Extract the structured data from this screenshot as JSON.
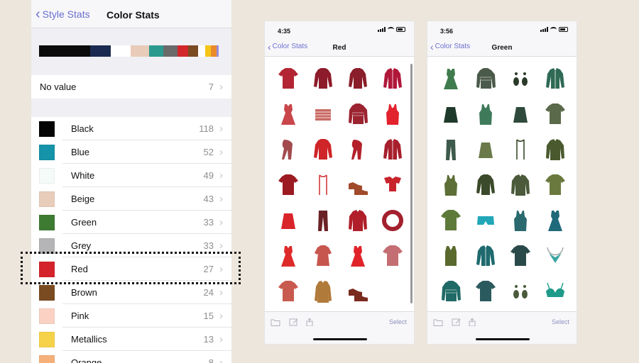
{
  "left_phone": {
    "back_label": "Style Stats",
    "title": "Color Stats",
    "swatch_bar": [
      "#0b0b0b",
      "#0b0b0b",
      "#1b2a50",
      "#ffffff",
      "#e8cbb8",
      "#2a9a8e",
      "#6a6a6a",
      "#d2262b",
      "#7a4a22",
      "#ffffff",
      "#f5c518",
      "#e98a2b",
      "#9b8cd9"
    ],
    "no_value": {
      "label": "No value",
      "count": "7"
    },
    "colors": [
      {
        "label": "Black",
        "count": "118",
        "swatch": "#050505"
      },
      {
        "label": "Blue",
        "count": "52",
        "swatch": "#1593a8"
      },
      {
        "label": "White",
        "count": "49",
        "swatch": "#f5fbf8"
      },
      {
        "label": "Beige",
        "count": "43",
        "swatch": "#e9cdbb"
      },
      {
        "label": "Green",
        "count": "33",
        "swatch": "#3e7b32"
      },
      {
        "label": "Grey",
        "count": "33",
        "swatch": "#b5b5b7"
      },
      {
        "label": "Red",
        "count": "27",
        "swatch": "#d4232a"
      },
      {
        "label": "Brown",
        "count": "24",
        "swatch": "#7a4a20"
      },
      {
        "label": "Pink",
        "count": "15",
        "swatch": "#fbd1c4"
      },
      {
        "label": "Metallics",
        "count": "13",
        "swatch": "#f6d24a"
      },
      {
        "label": "Orange",
        "count": "8",
        "swatch": "#f6b07a"
      }
    ]
  },
  "red_phone": {
    "time": "4:35",
    "back_label": "Color Stats",
    "title": "Red",
    "select_label": "Select",
    "items": [
      {
        "shape": "tee",
        "color": "#b32533"
      },
      {
        "shape": "long",
        "color": "#8e1b2a"
      },
      {
        "shape": "long",
        "color": "#8a1e2a"
      },
      {
        "shape": "cardigan",
        "color": "#b0183a"
      },
      {
        "shape": "dress",
        "color": "#c9464a"
      },
      {
        "shape": "clutch",
        "color": "#c96a65"
      },
      {
        "shape": "sweater",
        "color": "#9c2330"
      },
      {
        "shape": "tank",
        "color": "#e2222d"
      },
      {
        "shape": "scarf",
        "color": "#a24a4e"
      },
      {
        "shape": "long",
        "color": "#cf2428"
      },
      {
        "shape": "scarf",
        "color": "#b3202a"
      },
      {
        "shape": "cardigan",
        "color": "#a8202d"
      },
      {
        "shape": "tee",
        "color": "#9c1a22"
      },
      {
        "shape": "strap",
        "color": "#d23a3a"
      },
      {
        "shape": "shoes",
        "color": "#a14a2a"
      },
      {
        "shape": "top",
        "color": "#c8242c"
      },
      {
        "shape": "skirt",
        "color": "#d9242a"
      },
      {
        "shape": "pants",
        "color": "#6b2226"
      },
      {
        "shape": "jacket",
        "color": "#b01f2a"
      },
      {
        "shape": "loop",
        "color": "#a3202e"
      },
      {
        "shape": "dress",
        "color": "#df2a2a"
      },
      {
        "shape": "blouse",
        "color": "#c7564e"
      },
      {
        "shape": "dress",
        "color": "#e0242a"
      },
      {
        "shape": "tee",
        "color": "#c46d72"
      },
      {
        "shape": "tee",
        "color": "#c95a4f"
      },
      {
        "shape": "coat",
        "color": "#b07a3a"
      },
      {
        "shape": "shoes",
        "color": "#7a2a1e"
      }
    ]
  },
  "green_phone": {
    "time": "3:56",
    "back_label": "Color Stats",
    "title": "Green",
    "select_label": "Select",
    "items": [
      {
        "shape": "dress",
        "color": "#3f7b4d"
      },
      {
        "shape": "sweater",
        "color": "#4a5a4a"
      },
      {
        "shape": "earrings",
        "color": "#2a3a2a"
      },
      {
        "shape": "cardigan",
        "color": "#2f6a55"
      },
      {
        "shape": "skirt",
        "color": "#1f3a2a"
      },
      {
        "shape": "tank",
        "color": "#3f7a5a"
      },
      {
        "shape": "skirt",
        "color": "#2f4a3d"
      },
      {
        "shape": "tee",
        "color": "#5a6a4a"
      },
      {
        "shape": "pants",
        "color": "#3e5a4d"
      },
      {
        "shape": "skirt",
        "color": "#6a7a4a"
      },
      {
        "shape": "strap",
        "color": "#3a4a2a"
      },
      {
        "shape": "jacket",
        "color": "#4a5a2e"
      },
      {
        "shape": "tank",
        "color": "#5d6e36"
      },
      {
        "shape": "long",
        "color": "#3b4a2a"
      },
      {
        "shape": "jacket",
        "color": "#4a5a3a"
      },
      {
        "shape": "tee",
        "color": "#6a7a3e"
      },
      {
        "shape": "tee",
        "color": "#5e7a3a"
      },
      {
        "shape": "shorts",
        "color": "#22a6b8"
      },
      {
        "shape": "tank",
        "color": "#2a6a6e"
      },
      {
        "shape": "dress",
        "color": "#1e6a7a"
      },
      {
        "shape": "vest",
        "color": "#5a6a2e"
      },
      {
        "shape": "cardigan",
        "color": "#1e6a6e"
      },
      {
        "shape": "tee",
        "color": "#2a4a4a"
      },
      {
        "shape": "necklace",
        "color": "#3aa5a0"
      },
      {
        "shape": "sweater",
        "color": "#1f6a66"
      },
      {
        "shape": "tee",
        "color": "#2a5a5e"
      },
      {
        "shape": "earrings",
        "color": "#4a5a3a"
      },
      {
        "shape": "bra",
        "color": "#1f9b8a"
      }
    ]
  }
}
